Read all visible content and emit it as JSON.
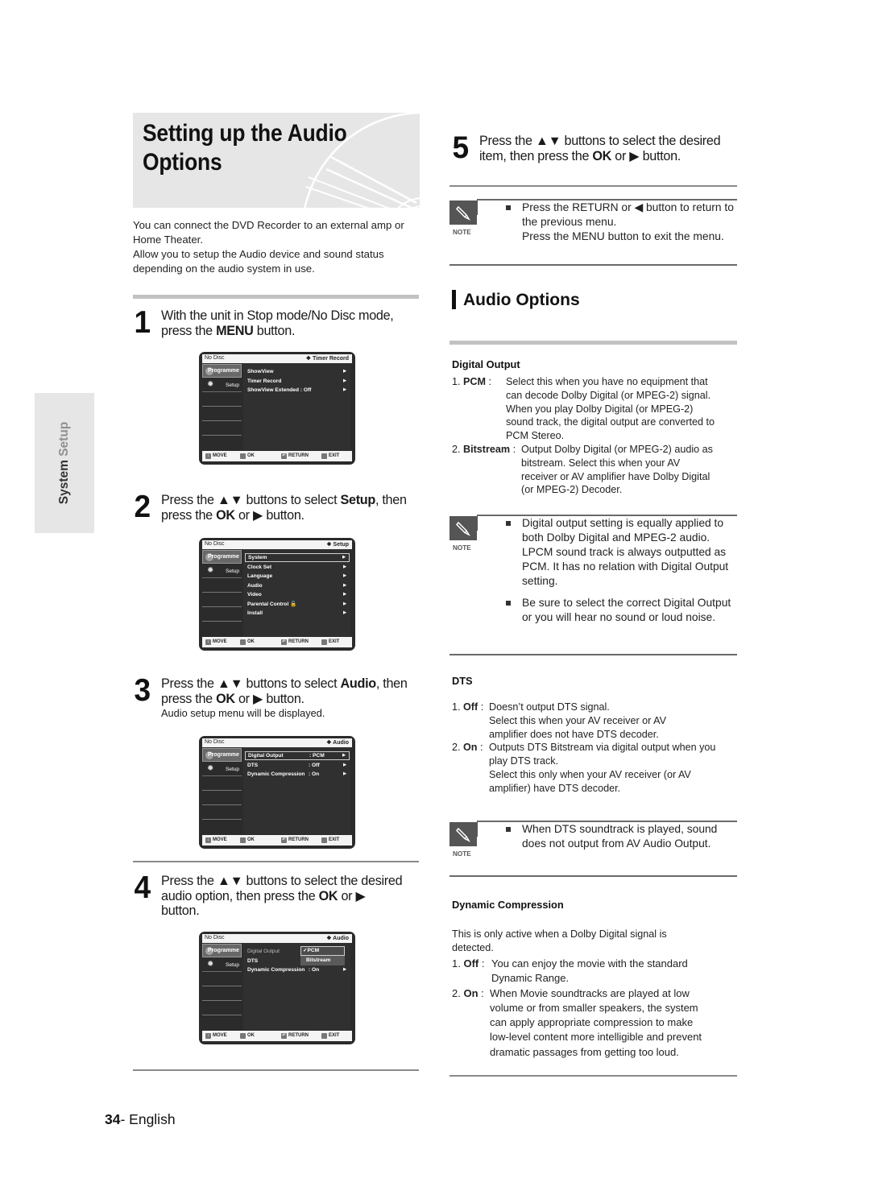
{
  "header": {
    "title_line1": "Setting up the Audio",
    "title_line2": "Options"
  },
  "intro": [
    "You can connect the DVD Recorder to an external amp or Home Theater.",
    "Allow you to setup the Audio device and sound status depending on the audio system in use."
  ],
  "side_tab": {
    "word1": "System",
    "word2": "Setup"
  },
  "steps": [
    {
      "num": "1",
      "text_a": "With the unit in Stop mode/No Disc mode,",
      "text_b_pre": "press the ",
      "text_b_bold": "MENU",
      "text_b_post": " button."
    },
    {
      "num": "2",
      "text_a_pre": "Press the ▲▼ buttons to select ",
      "text_a_bold": "Setup",
      "text_a_post": ", then",
      "text_b_pre": "press the ",
      "text_b_bold": "OK",
      "text_b_post": " or ▶ button."
    },
    {
      "num": "3",
      "text_a_pre": "Press the ▲▼ buttons to select ",
      "text_a_bold": "Audio",
      "text_a_post": ", then",
      "text_b_pre": "press the ",
      "text_b_bold": "OK",
      "text_b_post": " or ▶ button.",
      "sub": "Audio setup menu will be displayed."
    },
    {
      "num": "4",
      "text_a": "Press the ▲▼ buttons to select the desired",
      "text_b_pre": "audio option, then press the ",
      "text_b_bold": "OK",
      "text_b_post": " or ▶",
      "text_c": "button."
    },
    {
      "num": "5",
      "text_a": "Press the ▲▼ buttons to select the desired",
      "text_b_pre": "item, then press the ",
      "text_b_bold": "OK",
      "text_b_post": " or ▶ button."
    }
  ],
  "osd": {
    "status": "No Disc",
    "side_programme": "Programme",
    "side_setup": "Setup",
    "keys": {
      "move": "MOVE",
      "ok": "OK",
      "return": "RETURN",
      "exit": "EXIT"
    },
    "arrow": "▶",
    "screens": [
      {
        "breadcrumb": "❖ Timer Record",
        "items": [
          {
            "label": "ShowView",
            "value": ""
          },
          {
            "label": "Timer Record",
            "value": ""
          },
          {
            "label": "ShowView Extended : Off",
            "value": ""
          }
        ]
      },
      {
        "breadcrumb": "❖ Setup",
        "items": [
          {
            "label": "System",
            "value": ""
          },
          {
            "label": "Clock Set",
            "value": ""
          },
          {
            "label": "Language",
            "value": ""
          },
          {
            "label": "Audio",
            "value": ""
          },
          {
            "label": "Video",
            "value": ""
          },
          {
            "label": "Parental Control 🔓",
            "value": ""
          },
          {
            "label": "Install",
            "value": ""
          }
        ]
      },
      {
        "breadcrumb": "❖ Audio",
        "items": [
          {
            "label": "Digital Output",
            "value": ": PCM"
          },
          {
            "label": "DTS",
            "value": ": Off"
          },
          {
            "label": "Dynamic Compression",
            "value": ": On"
          }
        ]
      },
      {
        "breadcrumb": "❖ Audio",
        "items": [
          {
            "label": "Digital Output",
            "value": ""
          },
          {
            "label": "DTS",
            "value": ""
          },
          {
            "label": "Dynamic Compression",
            "value": ": On"
          }
        ],
        "popup": [
          "✓PCM",
          "Bitstream"
        ]
      }
    ]
  },
  "notes": {
    "label": "NOTE",
    "note1": [
      "Press the RETURN or ◀ button to return to the previous menu.",
      "Press the MENU button to exit the menu."
    ],
    "note2": [
      "Digital output setting is equally applied to both Dolby Digital and MPEG-2 audio. LPCM sound track is always outputted as PCM. It has no relation with Digital Output setting.",
      "Be sure to select the correct Digital Output or you will hear no sound or loud noise."
    ],
    "note3": [
      "When DTS soundtrack is played, sound does not output from AV Audio Output."
    ]
  },
  "audio_options": {
    "title": "Audio Options",
    "digital_output": {
      "heading": "Digital Output",
      "items": [
        {
          "num": "1. ",
          "term": "PCM",
          "sep": " :",
          "lines": [
            "Select this when you have no equipment that",
            "can decode Dolby Digital (or MPEG-2) signal.",
            "When you play Dolby Digital (or MPEG-2)",
            "sound track, the digital output are converted to",
            "PCM Stereo."
          ]
        },
        {
          "num": "2. ",
          "term": "Bitstream",
          "sep": " : ",
          "lines": [
            "Output Dolby Digital (or MPEG-2) audio as",
            "bitstream. Select this when your AV",
            "receiver or AV amplifier have Dolby Digital",
            "(or MPEG-2) Decoder."
          ]
        }
      ]
    },
    "dts": {
      "heading": "DTS",
      "items": [
        {
          "num": "1. ",
          "term": "Off",
          "sep": " : ",
          "lines": [
            "Doesn’t output DTS signal.",
            "Select this when your AV receiver or AV",
            "amplifier does not have DTS decoder."
          ]
        },
        {
          "num": "2. ",
          "term": "On",
          "sep": " : ",
          "lines": [
            "Outputs DTS Bitstream via digital output when you",
            "play DTS track.",
            "Select this only when your AV receiver (or AV",
            "amplifier) have DTS decoder."
          ]
        }
      ]
    },
    "dynamic_compression": {
      "heading": "Dynamic Compression",
      "intro": [
        "This is only active when a Dolby Digital signal is",
        "detected."
      ],
      "items": [
        {
          "num": "1. ",
          "term": "Off",
          "sep": " : ",
          "lines": [
            "You can enjoy the movie with the standard",
            "Dynamic Range."
          ]
        },
        {
          "num": "2. ",
          "term": "On",
          "sep": " :",
          "lines": [
            "When Movie soundtracks are played at low",
            "volume or from smaller speakers, the system",
            "can apply appropriate compression to make",
            "low-level content more intelligible and prevent",
            "dramatic passages from getting too loud."
          ]
        }
      ]
    }
  },
  "footer": {
    "page_number": "34",
    "language": "- English"
  }
}
